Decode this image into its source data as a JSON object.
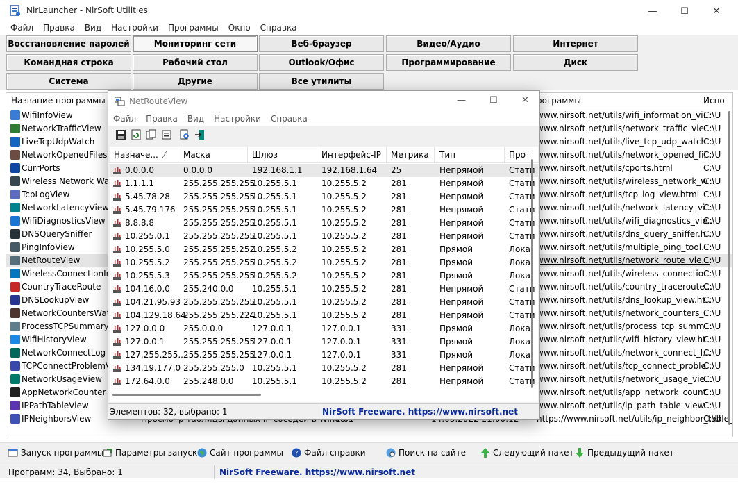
{
  "window": {
    "title": "NirLauncher  -  NirSoft Utilities",
    "minimize": "—",
    "maximize": "☐",
    "close": "✕"
  },
  "menu": [
    "Файл",
    "Правка",
    "Вид",
    "Настройки",
    "Программы",
    "Окно",
    "Справка"
  ],
  "categories": {
    "row1": [
      "Восстановление паролей",
      "Мониторинг сети",
      "Веб-браузер",
      "Видео/Аудио",
      "Интернет"
    ],
    "row2": [
      "Командная строка",
      "Рабочий стол",
      "Outlook/Офис",
      "Программирование",
      "Диск"
    ],
    "row3": [
      "Система",
      "Другие",
      "Все утилиты"
    ],
    "active": "Мониторинг сети"
  },
  "main_list": {
    "headers": {
      "name": "Название программы",
      "url": "рограммы",
      "path": "Испо"
    },
    "rows": [
      {
        "name": "WifiInfoView",
        "url": "www.nirsoft.net/utils/wifi_information_vi...",
        "path": "C:\\U",
        "color": "#3a7bd5"
      },
      {
        "name": "NetworkTrafficView",
        "url": "www.nirsoft.net/utils/network_traffic_vie...",
        "path": "C:\\U",
        "color": "#2e7d32"
      },
      {
        "name": "LiveTcpUdpWatch",
        "url": "www.nirsoft.net/utils/live_tcp_udp_watch...",
        "path": "C:\\U",
        "color": "#1565c0"
      },
      {
        "name": "NetworkOpenedFiles",
        "url": "www.nirsoft.net/utils/network_opened_fil...",
        "path": "C:\\U",
        "color": "#6d4c41"
      },
      {
        "name": "CurrPorts",
        "url": "www.nirsoft.net/utils/cports.html",
        "path": "C:\\U",
        "color": "#0d47a1"
      },
      {
        "name": "Wireless Network Watch",
        "url": "www.nirsoft.net/utils/wireless_network_w...",
        "path": "C:\\U",
        "color": "#37474f"
      },
      {
        "name": "TcpLogView",
        "url": "www.nirsoft.net/utils/tcp_log_view.html",
        "path": "C:\\U",
        "color": "#5c6bc0"
      },
      {
        "name": "NetworkLatencyView",
        "url": "www.nirsoft.net/utils/network_latency_vi...",
        "path": "C:\\U",
        "color": "#00838f"
      },
      {
        "name": "WifiDiagnosticsView",
        "url": "www.nirsoft.net/utils/wifi_diagnostics_vie...",
        "path": "C:\\U",
        "color": "#1976d2"
      },
      {
        "name": "DNSQuerySniffer",
        "url": "www.nirsoft.net/utils/dns_query_sniffer.h...",
        "path": "C:\\U",
        "color": "#263238"
      },
      {
        "name": "PingInfoView",
        "url": "www.nirsoft.net/utils/multiple_ping_tool....",
        "path": "C:\\U",
        "color": "#455a64"
      },
      {
        "name": "NetRouteView",
        "url": "www.nirsoft.net/utils/network_route_vie...",
        "path": "C:\\U",
        "color": "#546e7a",
        "selected": true
      },
      {
        "name": "WirelessConnectionInfo",
        "url": "www.nirsoft.net/utils/wireless_connectio...",
        "path": "C:\\U",
        "color": "#0277bd"
      },
      {
        "name": "CountryTraceRoute",
        "url": "www.nirsoft.net/utils/country_traceroute....",
        "path": "C:\\U",
        "color": "#c62828"
      },
      {
        "name": "DNSLookupView",
        "url": "www.nirsoft.net/utils/dns_lookup_view.ht...",
        "path": "C:\\U",
        "color": "#283593"
      },
      {
        "name": "NetworkCountersWatch",
        "url": "www.nirsoft.net/utils/network_counters_...",
        "path": "C:\\U",
        "color": "#4e342e"
      },
      {
        "name": "ProcessTCPSummary",
        "url": "www.nirsoft.net/utils/process_tcp_summ...",
        "path": "C:\\U",
        "color": "#607d8b"
      },
      {
        "name": "WifiHistoryView",
        "url": "www.nirsoft.net/utils/wifi_history_view.ht...",
        "path": "C:\\U",
        "color": "#1e88e5"
      },
      {
        "name": "NetworkConnectLog",
        "url": "www.nirsoft.net/utils/network_connect_l...",
        "path": "C:\\U",
        "color": "#00695c"
      },
      {
        "name": "TCPConnectProblemVie",
        "url": "www.nirsoft.net/utils/tcp_connect_proble...",
        "path": "C:\\U",
        "color": "#3949ab"
      },
      {
        "name": "NetworkUsageView",
        "url": "www.nirsoft.net/utils/network_usage_vie...",
        "path": "C:\\U",
        "color": "#00796b"
      },
      {
        "name": "AppNetworkCounter",
        "url": "www.nirsoft.net/utils/app_network_count...",
        "path": "C:\\U",
        "color": "#212121"
      },
      {
        "name": "IPPathTableView",
        "url": "www.nirsoft.net/utils/ip_path_table_view...",
        "path": "C:\\U",
        "color": "#5e35b1"
      },
      {
        "name": "IPNeighborsView",
        "desc": "Просмотр таблицы данных IP-соседей в Windo...",
        "ver": "1.01",
        "date": "14.03.2022 21:00:12",
        "url": "https://www.nirsoft.net/utils/ip_neighbor_table_...",
        "path": "C:\\U",
        "color": "#3f51b5"
      }
    ]
  },
  "bottom_toolbar": [
    {
      "label": "Запуск программы",
      "icon": "run-icon"
    },
    {
      "label": "Параметры запуска",
      "icon": "params-icon"
    },
    {
      "label": "Сайт программы",
      "icon": "globe-icon"
    },
    {
      "label": "Файл справки",
      "icon": "help-icon"
    },
    {
      "label": "Поиск на сайте",
      "icon": "search-web-icon"
    },
    {
      "label": "Следующий пакет",
      "icon": "arrow-up-icon"
    },
    {
      "label": "Предыдущий пакет",
      "icon": "arrow-down-icon"
    }
  ],
  "status": {
    "left": "Программ: 34, Выбрано: 1",
    "link": "NirSoft Freeware. https://www.nirsoft.net"
  },
  "nrv": {
    "title": "NetRouteView",
    "menu": [
      "Файл",
      "Правка",
      "Вид",
      "Настройки",
      "Справка"
    ],
    "headers": [
      "Назначе...",
      "Маска",
      "Шлюз",
      "Интерфейс-IP",
      "Метрика",
      "Тип",
      "Прот"
    ],
    "rows": [
      [
        "0.0.0.0",
        "0.0.0.0",
        "192.168.1.1",
        "192.168.1.64",
        "25",
        "Непрямой",
        "Стати"
      ],
      [
        "1.1.1.1",
        "255.255.255.255",
        "10.255.5.1",
        "10.255.5.2",
        "281",
        "Непрямой",
        "Стати"
      ],
      [
        "5.45.78.28",
        "255.255.255.255",
        "10.255.5.1",
        "10.255.5.2",
        "281",
        "Непрямой",
        "Стати"
      ],
      [
        "5.45.79.176",
        "255.255.255.255",
        "10.255.5.1",
        "10.255.5.2",
        "281",
        "Непрямой",
        "Стати"
      ],
      [
        "8.8.8.8",
        "255.255.255.255",
        "10.255.5.1",
        "10.255.5.2",
        "281",
        "Непрямой",
        "Стати"
      ],
      [
        "10.255.0.1",
        "255.255.255.255",
        "10.255.5.1",
        "10.255.5.2",
        "281",
        "Непрямой",
        "Стати"
      ],
      [
        "10.255.5.0",
        "255.255.255.252",
        "10.255.5.2",
        "10.255.5.2",
        "281",
        "Прямой",
        "Лока."
      ],
      [
        "10.255.5.2",
        "255.255.255.255",
        "10.255.5.2",
        "10.255.5.2",
        "281",
        "Прямой",
        "Лока."
      ],
      [
        "10.255.5.3",
        "255.255.255.255",
        "10.255.5.2",
        "10.255.5.2",
        "281",
        "Прямой",
        "Лока."
      ],
      [
        "104.16.0.0",
        "255.240.0.0",
        "10.255.5.1",
        "10.255.5.2",
        "281",
        "Непрямой",
        "Стати"
      ],
      [
        "104.21.95.93",
        "255.255.255.255",
        "10.255.5.1",
        "10.255.5.2",
        "281",
        "Непрямой",
        "Стати"
      ],
      [
        "104.129.18.64",
        "255.255.255.224",
        "10.255.5.1",
        "10.255.5.2",
        "281",
        "Непрямой",
        "Стати"
      ],
      [
        "127.0.0.0",
        "255.0.0.0",
        "127.0.0.1",
        "127.0.0.1",
        "331",
        "Прямой",
        "Лока."
      ],
      [
        "127.0.0.1",
        "255.255.255.255",
        "127.0.0.1",
        "127.0.0.1",
        "331",
        "Прямой",
        "Лока."
      ],
      [
        "127.255.255....",
        "255.255.255.255",
        "127.0.0.1",
        "127.0.0.1",
        "331",
        "Прямой",
        "Лока."
      ],
      [
        "134.19.177.0",
        "255.255.255.0",
        "10.255.5.1",
        "10.255.5.2",
        "281",
        "Непрямой",
        "Стати"
      ],
      [
        "172.64.0.0",
        "255.248.0.0",
        "10.255.5.1",
        "10.255.5.2",
        "281",
        "Непрямой",
        "Стати"
      ]
    ],
    "status": "Элементов: 32, выбрано: 1",
    "link": "NirSoft Freeware. https://www.nirsoft.net"
  }
}
